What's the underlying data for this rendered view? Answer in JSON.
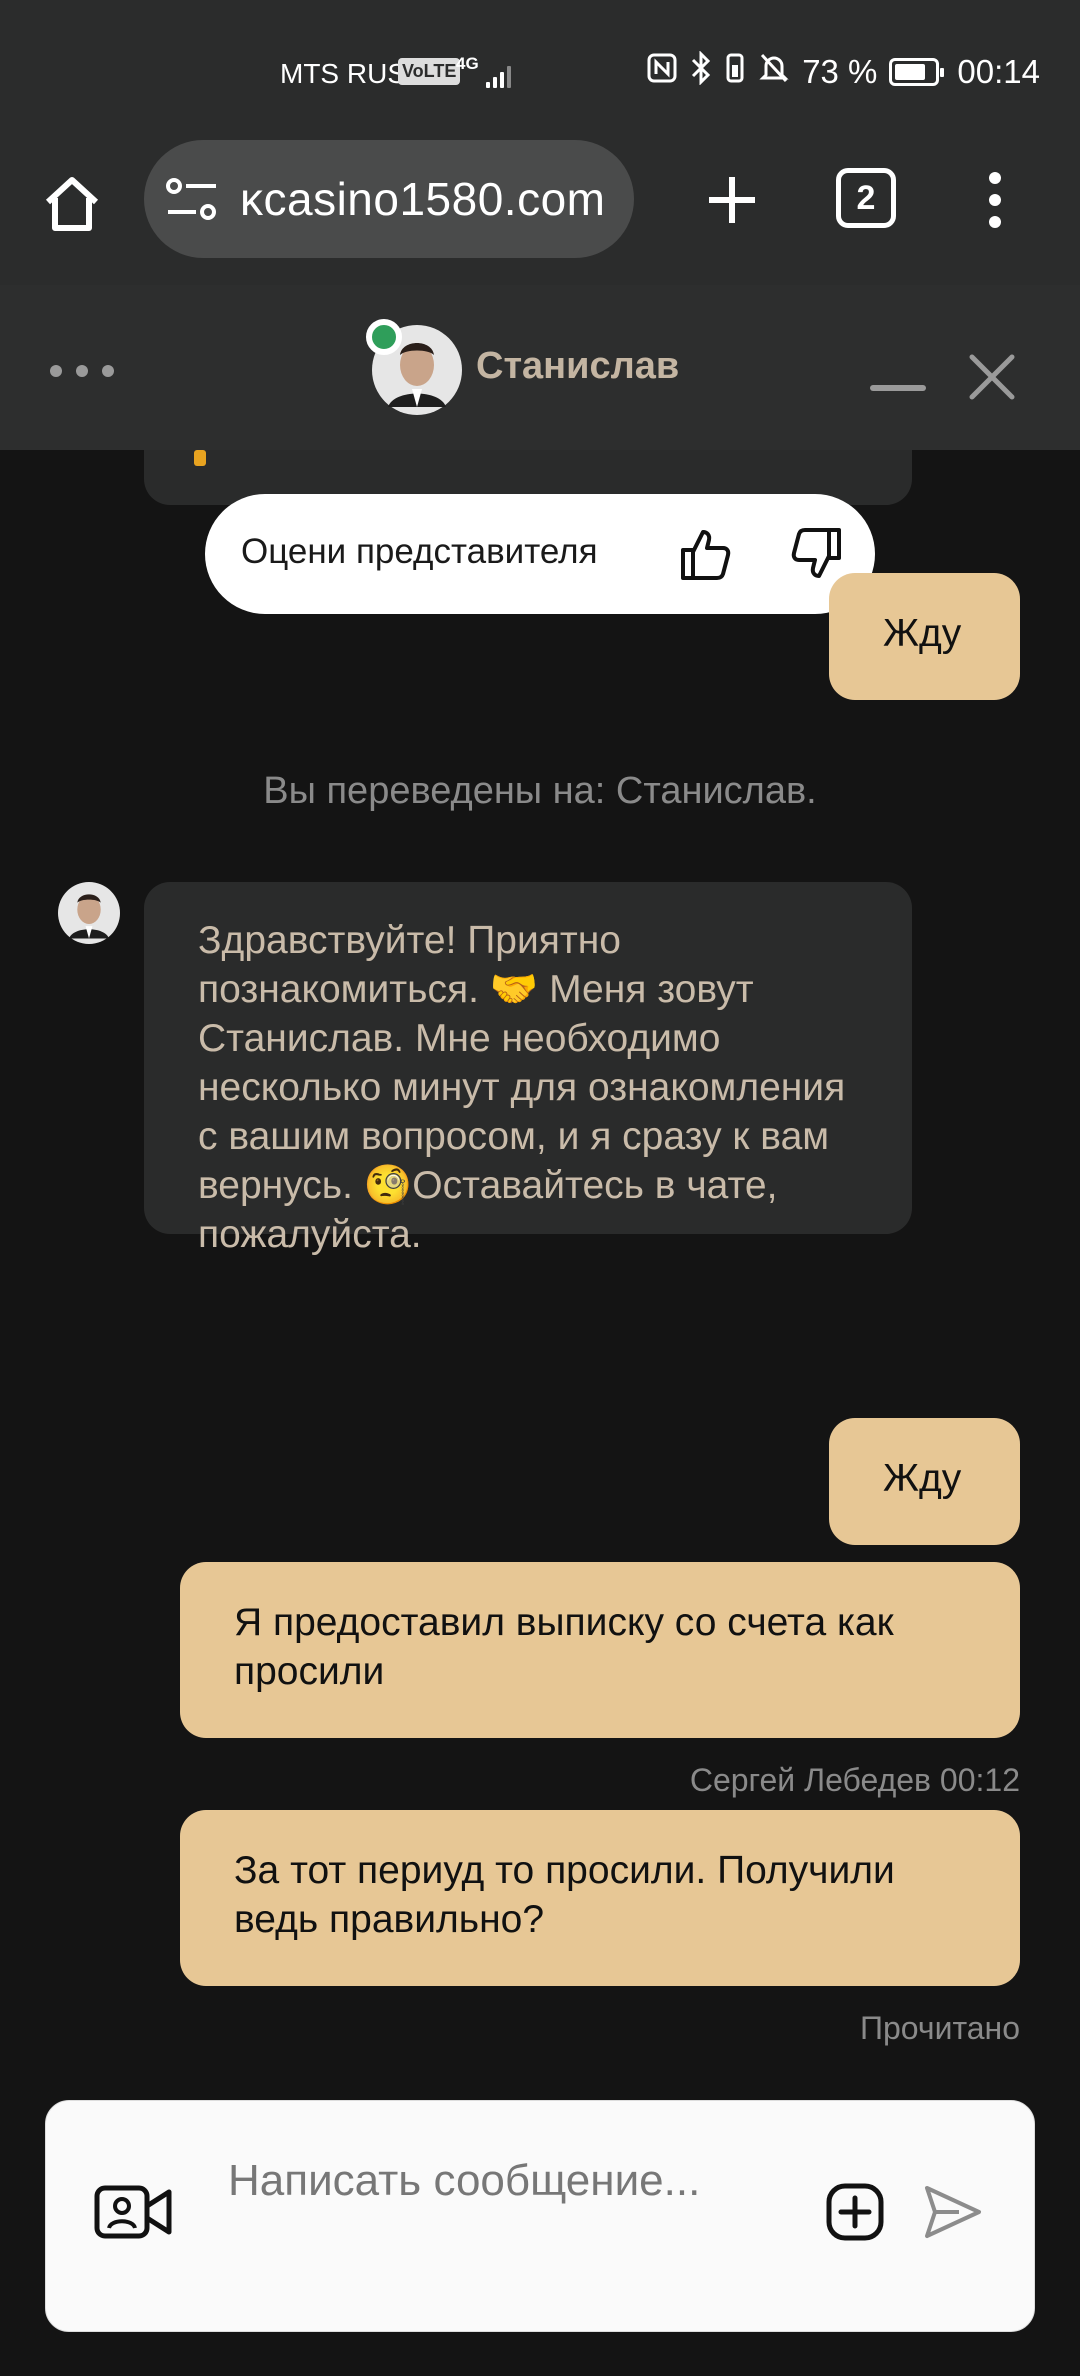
{
  "status_bar": {
    "carrier": "MTS RUS",
    "volte": "VoLTE",
    "network": "4G",
    "battery_percent": "73 %",
    "time": "00:14"
  },
  "browser": {
    "url": "ĸcasino1580.com",
    "tab_count": "2"
  },
  "chat_header": {
    "agent_name": "Станислав",
    "online_color": "#2f9e5a"
  },
  "rating": {
    "label": "Оцени представителя"
  },
  "messages": [
    {
      "type": "out",
      "text": "Жду"
    },
    {
      "type": "system",
      "text": "Вы переведены на: Станислав."
    },
    {
      "type": "in",
      "text": "Здравствуйте! Приятно познакомиться. 🤝 Меня зовут Станислав. Мне необходимо несколько минут для ознакомления с вашим вопросом, и я сразу к вам вернусь. 🧐Оставайтесь в чате, пожалуйста."
    },
    {
      "type": "out",
      "text": "Жду"
    },
    {
      "type": "out",
      "text": "Я предоставил выписку со счета как просили"
    },
    {
      "type": "meta",
      "text": "Сергей Лебедев 00:12"
    },
    {
      "type": "out",
      "text": "За тот периуд то просили. Получили ведь правильно?"
    },
    {
      "type": "meta",
      "text": "Прочитано"
    }
  ],
  "composer": {
    "placeholder": "Написать сообщение..."
  },
  "colors": {
    "accent_bubble": "#e7c795",
    "agent_bubble": "#2a2b2b",
    "background": "#141414"
  }
}
